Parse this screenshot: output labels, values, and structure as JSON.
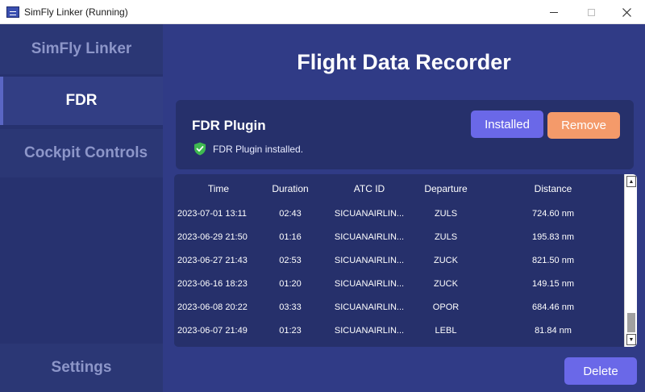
{
  "window": {
    "title": "SimFly Linker (Running)",
    "icons": {
      "minimize": "minimize-icon",
      "maximize": "maximize-icon",
      "close": "close-icon"
    }
  },
  "sidebar": {
    "app_name": "SimFly Linker",
    "items": [
      {
        "label": "FDR",
        "active": true
      },
      {
        "label": "Cockpit Controls",
        "active": false
      }
    ],
    "settings_label": "Settings"
  },
  "main": {
    "title": "Flight Data Recorder",
    "plugin": {
      "title": "FDR Plugin",
      "status_text": "FDR Plugin installed.",
      "status_icon": "shield-check-icon",
      "installed_label": "Installed",
      "remove_label": "Remove"
    },
    "table": {
      "columns": [
        "Time",
        "Duration",
        "ATC ID",
        "Departure",
        "Distance"
      ],
      "rows": [
        [
          "2023-07-01 13:11",
          "02:43",
          "SICUANAIRLIN...",
          "ZULS",
          "724.60 nm"
        ],
        [
          "2023-06-29 21:50",
          "01:16",
          "SICUANAIRLIN...",
          "ZULS",
          "195.83 nm"
        ],
        [
          "2023-06-27 21:43",
          "02:53",
          "SICUANAIRLIN...",
          "ZUCK",
          "821.50 nm"
        ],
        [
          "2023-06-16 18:23",
          "01:20",
          "SICUANAIRLIN...",
          "ZUCK",
          "149.15 nm"
        ],
        [
          "2023-06-08 20:22",
          "03:33",
          "SICUANAIRLIN...",
          "OPOR",
          "684.46 nm"
        ],
        [
          "2023-06-07 21:49",
          "01:23",
          "SICUANAIRLIN...",
          "LEBL",
          "81.84 nm"
        ]
      ]
    },
    "delete_label": "Delete"
  },
  "colors": {
    "sidebar_bg": "#27326f",
    "main_bg": "#303b86",
    "card_bg": "#26306b",
    "primary_button": "#6a68e8",
    "remove_button": "#f49a6a",
    "status_icon": "#3fb950"
  }
}
